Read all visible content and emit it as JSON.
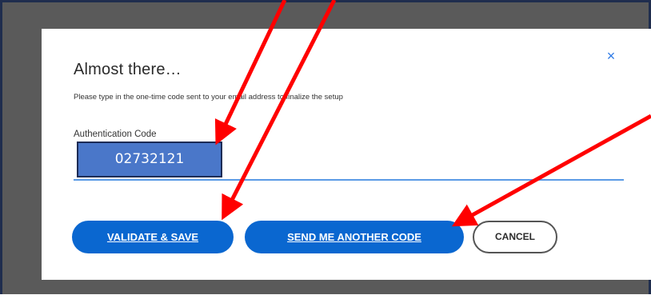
{
  "dialog": {
    "title": "Almost there…",
    "subtitle": "Please type in the one-time code sent to your email address to finalize the setup",
    "close_icon": "×",
    "field_label": "Authentication Code",
    "code_value": "02732121",
    "buttons": {
      "validate": "VALIDATE & SAVE",
      "send_another": "SEND ME ANOTHER CODE",
      "cancel": "CANCEL"
    }
  },
  "colors": {
    "overlay": "#5a5a5a",
    "primary_button": "#0a67d0",
    "code_highlight": "#4a77c9",
    "arrow": "#ff0000"
  },
  "icons": [
    "close-icon",
    "annotation-arrow"
  ]
}
